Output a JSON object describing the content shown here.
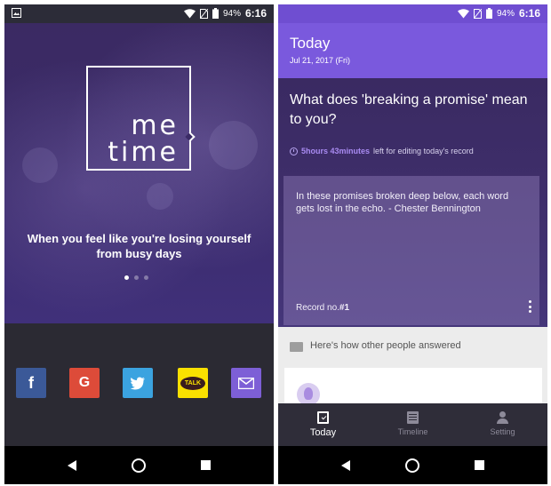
{
  "status_bar": {
    "battery": "94%",
    "time": "6:16"
  },
  "onboarding": {
    "logo_line1": "me",
    "logo_line2": "time",
    "tagline_line1": "When you feel like you're losing yourself",
    "tagline_line2": "from busy days",
    "page_indicator": {
      "total": 3,
      "current": 1
    },
    "social_buttons": [
      {
        "icon": "facebook-icon",
        "glyph": "f",
        "color": "#3b5998"
      },
      {
        "icon": "google-icon",
        "glyph": "G",
        "color": "#dd4b39"
      },
      {
        "icon": "twitter-icon",
        "color": "#3ba3e0"
      },
      {
        "icon": "kakaotalk-icon",
        "glyph": "TALK",
        "color": "#f9e000"
      },
      {
        "icon": "email-icon",
        "color": "#7d5fd6"
      }
    ]
  },
  "today_screen": {
    "header": {
      "title": "Today",
      "date": "Jul 21, 2017 (Fri)"
    },
    "question": "What does 'breaking a promise' mean to you?",
    "timer": {
      "value": "5hours 43minutes",
      "suffix": "left for editing today's record"
    },
    "record": {
      "quote": "In these promises broken deep below, each word gets lost in the echo. - Chester Bennington",
      "record_label": "Record no.",
      "record_number": "#1"
    },
    "others": {
      "label": "Here's how other people answered"
    },
    "tabs": [
      {
        "label": "Today",
        "icon": "calendar-check-icon",
        "active": true
      },
      {
        "label": "Timeline",
        "icon": "timeline-icon",
        "active": false
      },
      {
        "label": "Setting",
        "icon": "person-icon",
        "active": false
      }
    ]
  },
  "colors": {
    "accent": "#7a59dd",
    "timer_highlight": "#a98bf2",
    "tab_bar": "#2f2d39"
  }
}
